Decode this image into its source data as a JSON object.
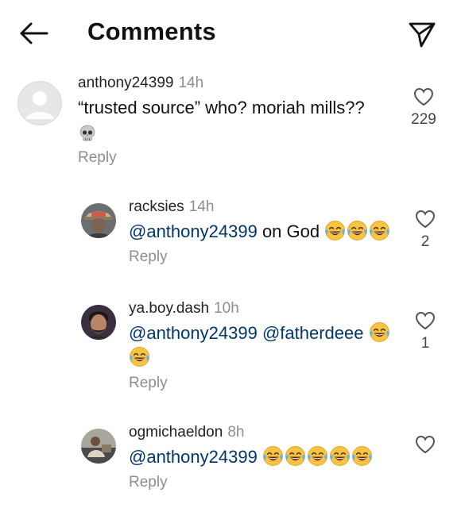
{
  "header": {
    "title": "Comments",
    "back_icon": "arrow-left-icon",
    "send_icon": "send-paper-plane-icon"
  },
  "colors": {
    "mention": "#00376b",
    "muted": "#8e8e8e",
    "text": "#111111",
    "emoji_face": "#f6c343"
  },
  "comments": [
    {
      "user": "anthony24399",
      "time": "14h",
      "text": "“trusted source” who? moriah mills??",
      "emoji": "skull",
      "reply_label": "Reply",
      "likes": "229"
    },
    {
      "user": "racksies",
      "time": "14h",
      "mentions": [
        "@anthony24399"
      ],
      "text": "on God",
      "emoji": "joy-face",
      "emoji_count": 3,
      "reply_label": "Reply",
      "likes": "2"
    },
    {
      "user": "ya.boy.dash",
      "time": "10h",
      "mentions": [
        "@anthony24399",
        "@fatherdeee"
      ],
      "emoji": "joy-face",
      "emoji_count": 2,
      "reply_label": "Reply",
      "likes": "1"
    },
    {
      "user": "ogmichaeldon",
      "time": "8h",
      "mentions": [
        "@anthony24399"
      ],
      "emoji": "joy-face",
      "emoji_count": 5,
      "reply_label": "Reply",
      "likes": ""
    }
  ]
}
